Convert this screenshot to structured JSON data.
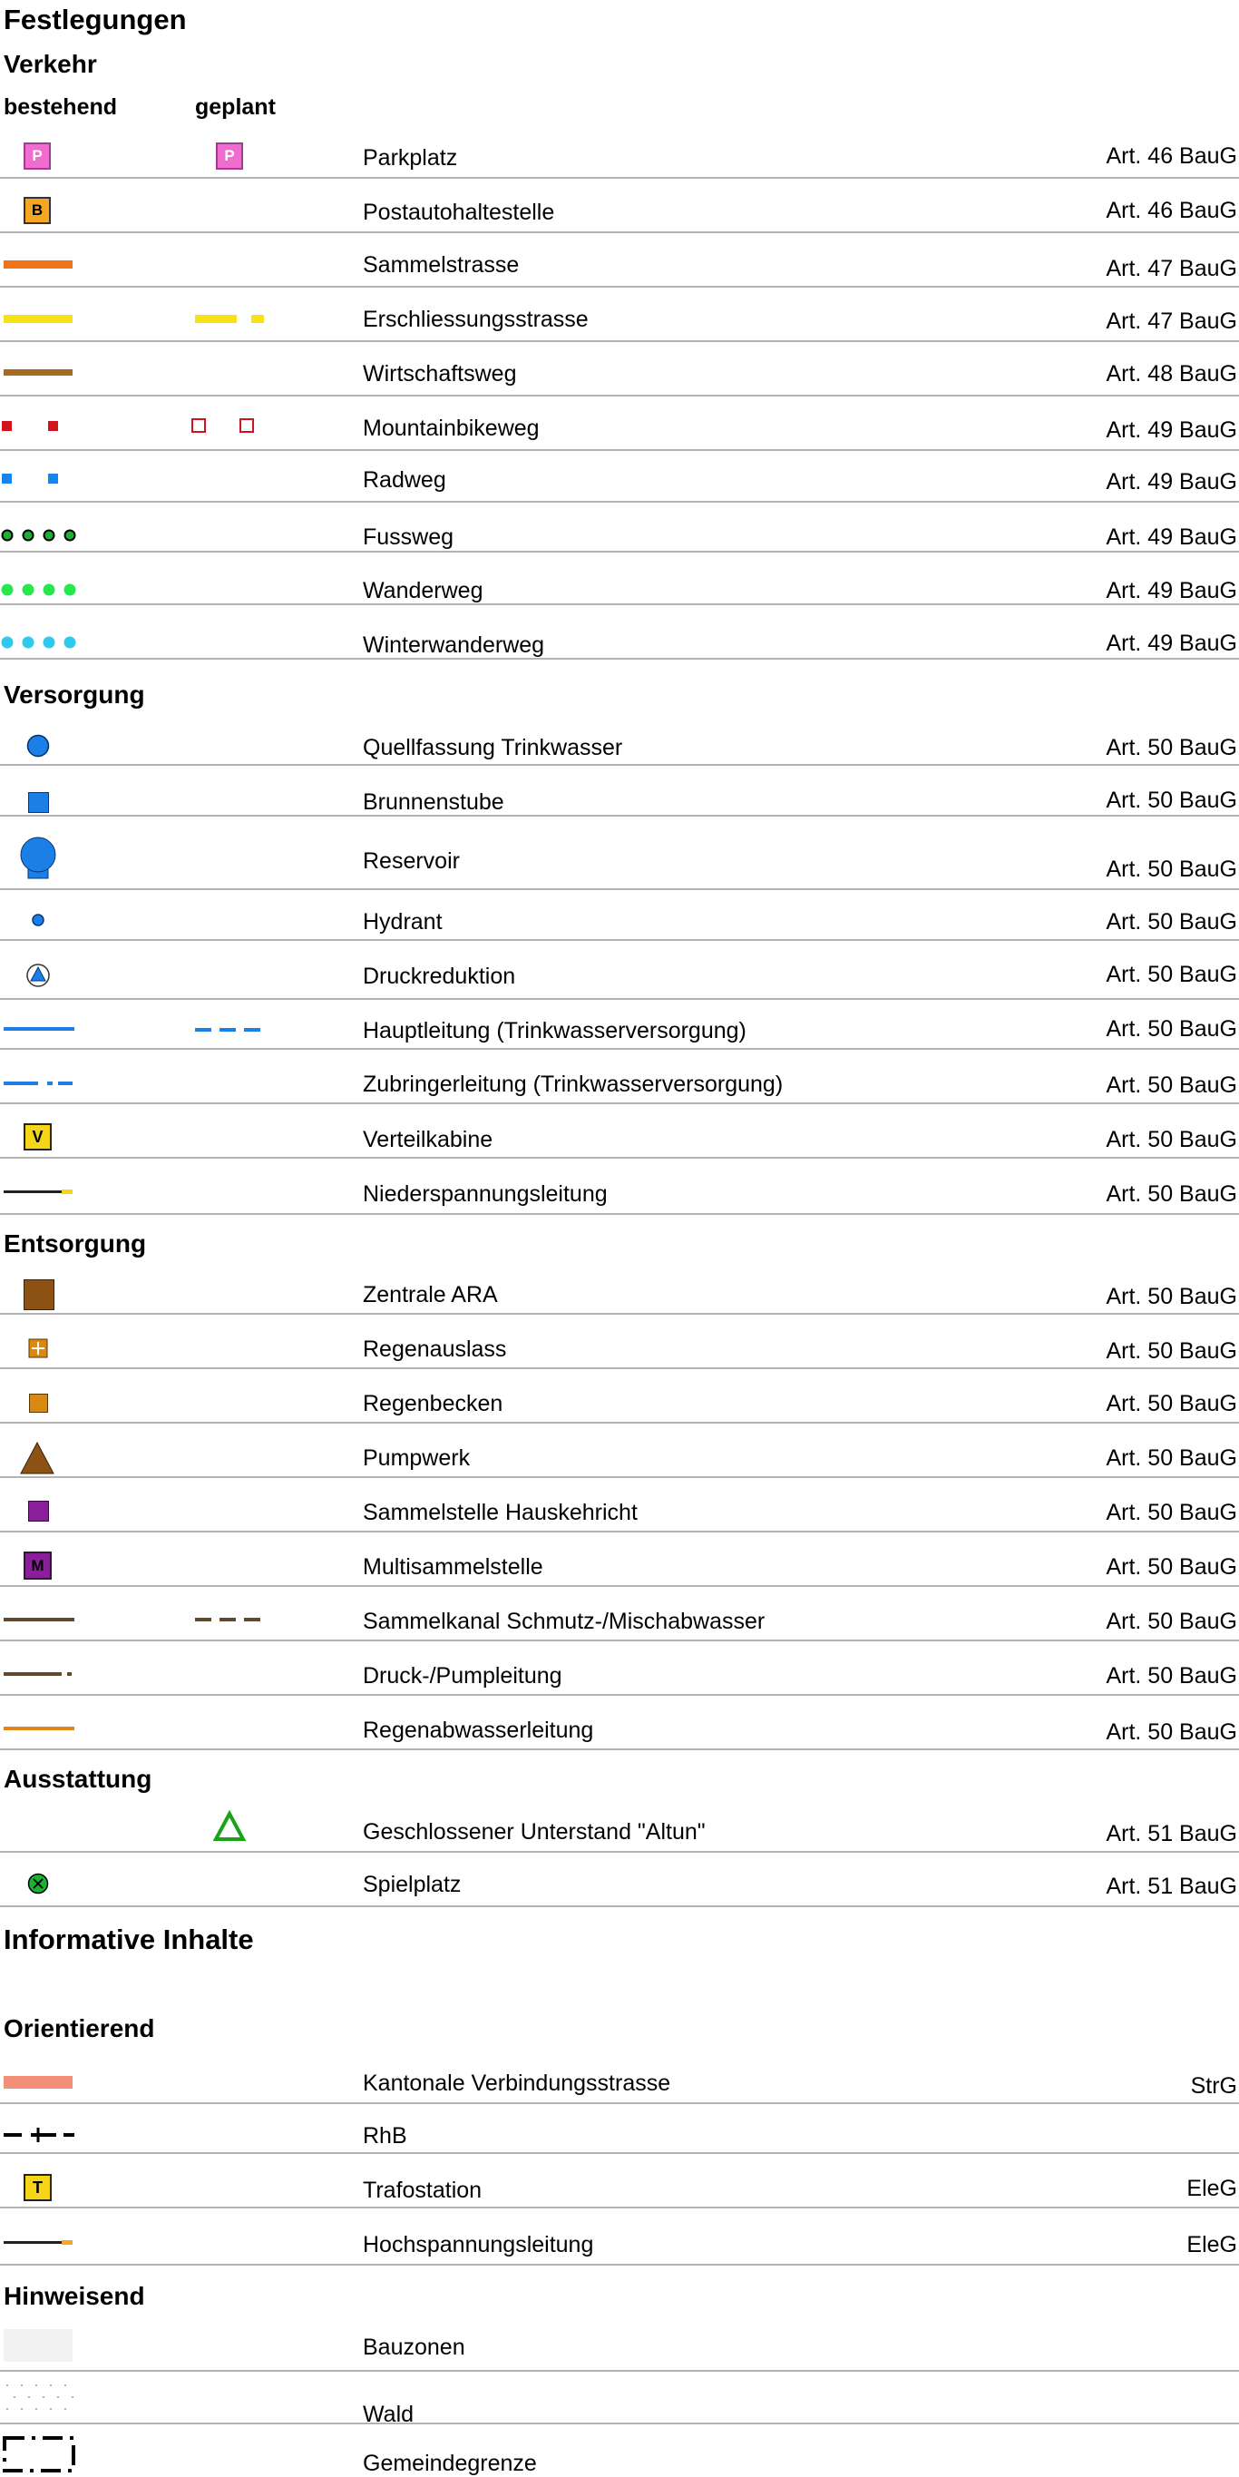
{
  "title": "Festlegungen",
  "sections": {
    "verkehr": "Verkehr",
    "versorgung": "Versorgung",
    "entsorgung": "Entsorgung",
    "ausstattung": "Ausstattung",
    "informative": "Informative Inhalte",
    "orientierend": "Orientierend",
    "hinweisend": "Hinweisend"
  },
  "columns": {
    "bestehend": "bestehend",
    "geplant": "geplant"
  },
  "verkehr": [
    {
      "icon": "parking-icon",
      "letter": "P",
      "label": "Parkplatz",
      "ref": "Art. 46 BauG"
    },
    {
      "icon": "bus-stop-icon",
      "letter": "B",
      "label": "Postautohaltestelle",
      "ref": "Art. 46 BauG"
    },
    {
      "icon": "collector-road-line",
      "label": "Sammelstrasse",
      "ref": "Art. 47 BauG"
    },
    {
      "icon": "access-road-line",
      "label": "Erschliessungsstrasse",
      "ref": "Art. 47 BauG"
    },
    {
      "icon": "farm-road-line",
      "label": "Wirtschaftsweg",
      "ref": "Art. 48 BauG"
    },
    {
      "icon": "mountainbike-path-line",
      "label": "Mountainbikeweg",
      "ref": "Art. 49 BauG"
    },
    {
      "icon": "bike-path-line",
      "label": "Radweg",
      "ref": "Art. 49 BauG"
    },
    {
      "icon": "footpath-dots",
      "label": "Fussweg",
      "ref": "Art. 49 BauG"
    },
    {
      "icon": "hiking-trail-dots",
      "label": "Wanderweg",
      "ref": "Art. 49 BauG"
    },
    {
      "icon": "winter-trail-dots",
      "label": "Winterwanderweg",
      "ref": "Art. 49 BauG"
    }
  ],
  "versorgung": [
    {
      "icon": "spring-catchment-icon",
      "label": "Quellfassung Trinkwasser",
      "ref": "Art. 50 BauG"
    },
    {
      "icon": "well-chamber-icon",
      "label": "Brunnenstube",
      "ref": "Art. 50 BauG"
    },
    {
      "icon": "reservoir-icon",
      "label": "Reservoir",
      "ref": "Art. 50 BauG"
    },
    {
      "icon": "hydrant-icon",
      "label": "Hydrant",
      "ref": "Art. 50 BauG"
    },
    {
      "icon": "pressure-reduction-icon",
      "label": "Druckreduktion",
      "ref": "Art. 50 BauG"
    },
    {
      "icon": "main-water-line",
      "label": "Hauptleitung (Trinkwasserversorgung)",
      "ref": "Art. 50 BauG"
    },
    {
      "icon": "feeder-water-line",
      "label": "Zubringerleitung (Trinkwasserversorgung)",
      "ref": "Art. 50 BauG"
    },
    {
      "icon": "distribution-cabinet-icon",
      "letter": "V",
      "label": "Verteilkabine",
      "ref": "Art. 50 BauG"
    },
    {
      "icon": "low-voltage-line",
      "label": "Niederspannungsleitung",
      "ref": "Art. 50 BauG"
    }
  ],
  "entsorgung": [
    {
      "icon": "central-wwtp-icon",
      "label": "Zentrale ARA",
      "ref": "Art. 50 BauG"
    },
    {
      "icon": "storm-outlet-icon",
      "label": "Regenauslass",
      "ref": "Art. 50 BauG"
    },
    {
      "icon": "storm-basin-icon",
      "label": "Regenbecken",
      "ref": "Art. 50 BauG"
    },
    {
      "icon": "pump-station-icon",
      "label": "Pumpwerk",
      "ref": "Art. 50 BauG"
    },
    {
      "icon": "waste-collection-icon",
      "label": "Sammelstelle Hauskehricht",
      "ref": "Art. 50 BauG"
    },
    {
      "icon": "multi-collection-icon",
      "letter": "M",
      "label": "Multisammelstelle",
      "ref": "Art. 50 BauG"
    },
    {
      "icon": "sewer-line",
      "label": "Sammelkanal Schmutz-/Mischabwasser",
      "ref": "Art. 50 BauG"
    },
    {
      "icon": "pressure-pipe-line",
      "label": "Druck-/Pumpleitung",
      "ref": "Art. 50 BauG"
    },
    {
      "icon": "stormwater-line",
      "label": "Regenabwasserleitung",
      "ref": "Art. 50 BauG"
    }
  ],
  "ausstattung": [
    {
      "icon": "shelter-triangle-icon",
      "label": "Geschlossener Unterstand \"Altun\"",
      "ref": "Art. 51 BauG"
    },
    {
      "icon": "playground-icon",
      "label": "Spielplatz",
      "ref": "Art. 51 BauG"
    }
  ],
  "orientierend": [
    {
      "icon": "cantonal-road-line",
      "label": "Kantonale Verbindungsstrasse",
      "ref": "StrG"
    },
    {
      "icon": "railway-line",
      "label": "RhB",
      "ref": ""
    },
    {
      "icon": "transformer-icon",
      "letter": "T",
      "label": "Trafostation",
      "ref": "EleG"
    },
    {
      "icon": "high-voltage-line",
      "label": "Hochspannungsleitung",
      "ref": "EleG"
    }
  ],
  "hinweisend": [
    {
      "icon": "building-zone-fill",
      "label": "Bauzonen",
      "ref": ""
    },
    {
      "icon": "forest-dots-fill",
      "label": "Wald",
      "ref": ""
    },
    {
      "icon": "municipal-boundary-icon",
      "label": "Gemeindegrenze",
      "ref": ""
    }
  ],
  "colors": {
    "rule": "#b3b3b3",
    "parking": "#f06ccf",
    "busstop": "#f5a623",
    "collector": "#f07317",
    "access": "#f7e315",
    "farmroad": "#a66a21",
    "mtb": "#d0131c",
    "bike": "#1883ea",
    "footpath": "#1ab233",
    "hiking": "#26e84a",
    "winter": "#2fc9ee",
    "water": "#1c7fe6",
    "cabinet": "#f6d519",
    "wwtp": "#8c5214",
    "storm": "#d9890f",
    "waste": "#8a1f9a",
    "sewer": "#5e4a2f",
    "stormline": "#e0861a",
    "shelter": "#19a319",
    "cantonal": "#f2907a",
    "bauzone": "#f2f2f2"
  }
}
